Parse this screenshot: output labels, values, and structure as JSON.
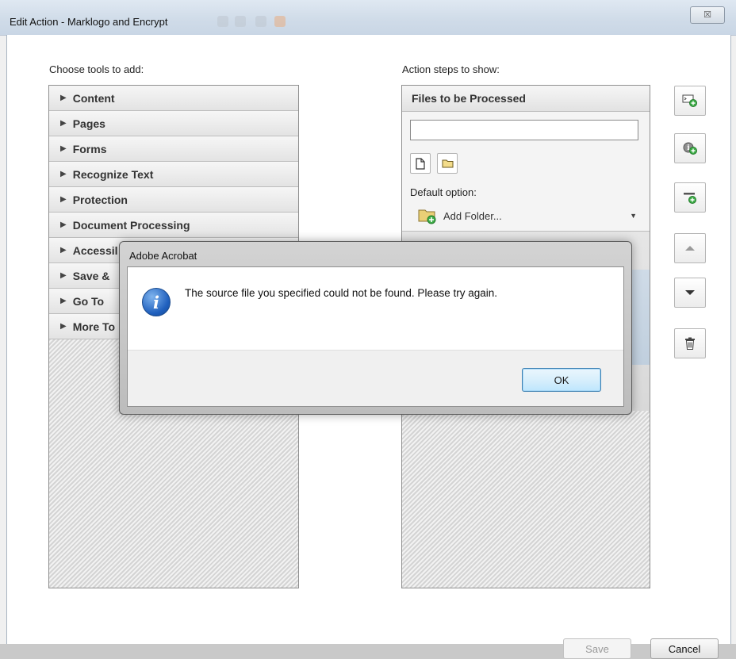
{
  "window": {
    "title": "Edit Action - Marklogo and Encrypt",
    "close_icon": "close-icon",
    "close_glyph": "☒"
  },
  "left_panel": {
    "label": "Choose tools to add:",
    "items": [
      {
        "label": "Content"
      },
      {
        "label": "Pages"
      },
      {
        "label": "Forms"
      },
      {
        "label": "Recognize Text"
      },
      {
        "label": "Protection"
      },
      {
        "label": "Document Processing"
      },
      {
        "label": "Accessil"
      },
      {
        "label": "Save &"
      },
      {
        "label": "Go To"
      },
      {
        "label": "More To"
      }
    ]
  },
  "right_panel": {
    "label": "Action steps to show:",
    "files_header": "Files to be Processed",
    "file_input_value": "",
    "default_option_label": "Default option:",
    "default_option_value": "Add Folder..."
  },
  "side_buttons": [
    {
      "icon": "add-instruction-icon"
    },
    {
      "icon": "add-info-icon"
    },
    {
      "icon": "add-divider-icon"
    },
    {
      "icon": "move-up-icon"
    },
    {
      "icon": "move-down-icon"
    },
    {
      "icon": "delete-trash-icon"
    }
  ],
  "footer": {
    "save_label": "Save",
    "cancel_label": "Cancel"
  },
  "modal": {
    "title": "Adobe Acrobat",
    "message": "The source file you specified could not be found. Please try again.",
    "ok_label": "OK",
    "icon": "info-icon",
    "icon_glyph": "i"
  }
}
